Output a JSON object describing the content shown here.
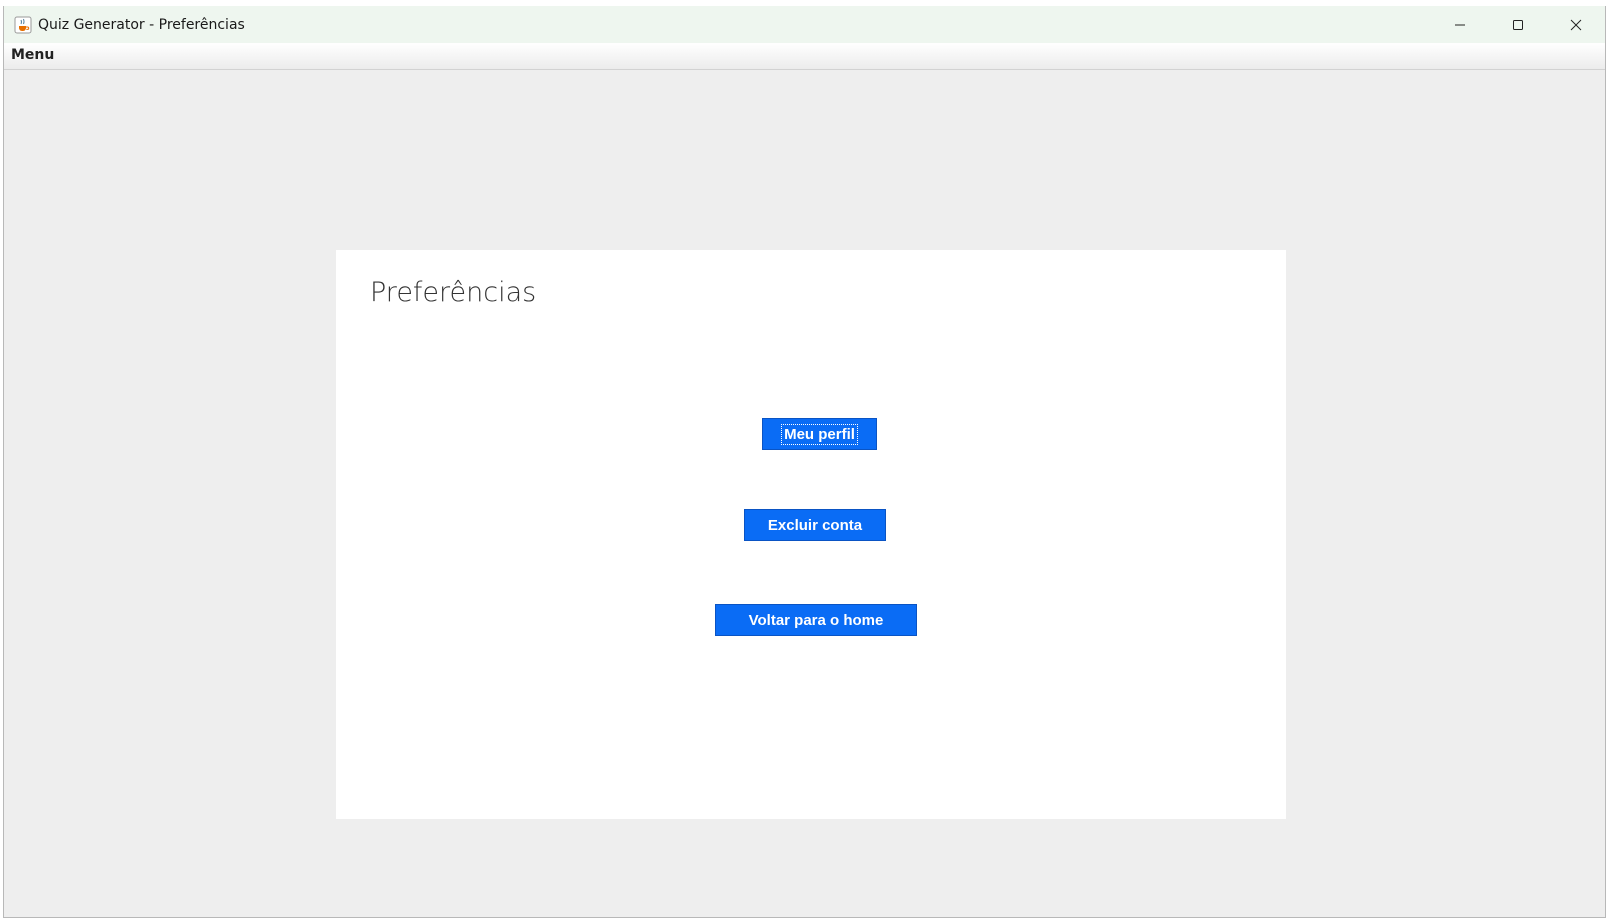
{
  "window": {
    "title": "Quiz Generator - Preferências",
    "icons": {
      "app": "java-coffee-cup-icon",
      "minimize": "minimize-icon",
      "maximize": "maximize-icon",
      "close": "close-icon"
    }
  },
  "menubar": {
    "items": [
      {
        "label": "Menu"
      }
    ]
  },
  "panel": {
    "title": "Preferências",
    "buttons": {
      "profile": "Meu perfil",
      "delete_account": "Excluir conta",
      "back_home": "Voltar para o home"
    }
  },
  "colors": {
    "button_bg": "#0a6cf5",
    "button_text": "#ffffff",
    "window_bg": "#eeeeee",
    "panel_bg": "#ffffff"
  }
}
